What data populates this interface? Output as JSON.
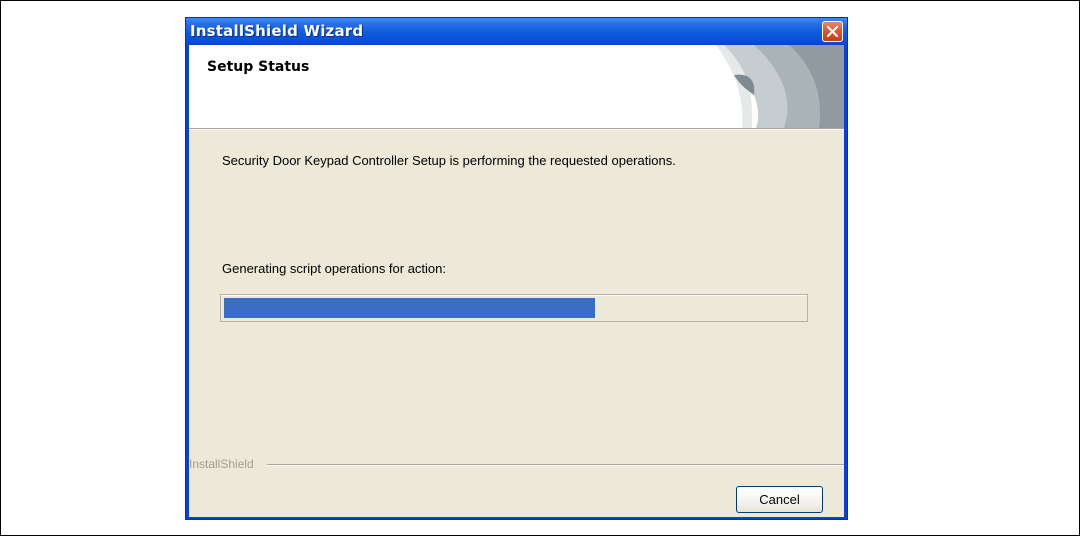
{
  "window": {
    "title": "InstallShield Wizard",
    "close_icon": "close-icon"
  },
  "header": {
    "title": "Setup Status"
  },
  "main": {
    "description": "Security Door Keypad Controller Setup is performing the requested operations.",
    "action_label": "Generating script operations for action:",
    "progress_fraction": 0.64
  },
  "footer": {
    "brand": "InstallShield",
    "cancel_label": "Cancel"
  },
  "colors": {
    "titlebar": "#0a4fd2",
    "progress": "#3a6dc6",
    "client": "#ece9d8",
    "close_button": "#d9542c"
  }
}
